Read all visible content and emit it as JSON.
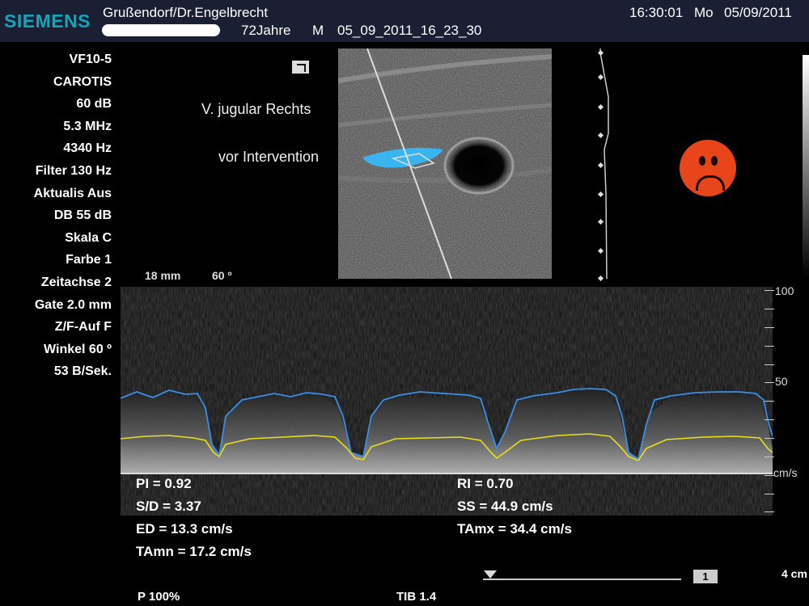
{
  "header": {
    "logo": "SIEMENS",
    "patient_name": "Grußendorf/Dr.Engelbrecht",
    "age": "72Jahre",
    "sex": "M",
    "study_id": "05_09_2011_16_23_30",
    "time": "16:30:01",
    "weekday": "Mo",
    "date": "05/09/2011"
  },
  "parameters": [
    "VF10-5",
    "CAROTIS",
    "60 dB",
    "5.3 MHz",
    "4340 Hz",
    "Filter 130 Hz",
    "Aktualis Aus",
    "DB 55 dB",
    "Skala C",
    "Farbe 1",
    "Zeitachse 2",
    "Gate 2.0 mm",
    "Z/F-Auf F",
    "Winkel 60 º",
    "53 B/Sek."
  ],
  "image": {
    "label_vessel": "V. jugular Rechts",
    "label_state": "vor Intervention",
    "depth": "18 mm",
    "angle": "60 º",
    "status_face": "sad-face-icon"
  },
  "doppler_scale": {
    "top": "100",
    "mid": "50",
    "unit": "cm/s"
  },
  "measurements": {
    "pi": "PI = 0.92",
    "sd": "S/D = 3.37",
    "ed": "ED = 13.3 cm/s",
    "tamn": "TAmn = 17.2 cm/s",
    "ri": "RI = 0.70",
    "ss": "SS = 44.9 cm/s",
    "tamx": "TAmx = 34.4 cm/s"
  },
  "footer": {
    "power": "P 100%",
    "tib": "TIB 1.4",
    "page": "1",
    "depth_cm": "4 cm"
  },
  "colors": {
    "logo": "#14a6b8",
    "header_bg": "#1a1f33",
    "envelope_max": "#3a8ee8",
    "envelope_mean": "#e8e01a",
    "face": "#e8451a",
    "flow": "#3ab4f0"
  }
}
